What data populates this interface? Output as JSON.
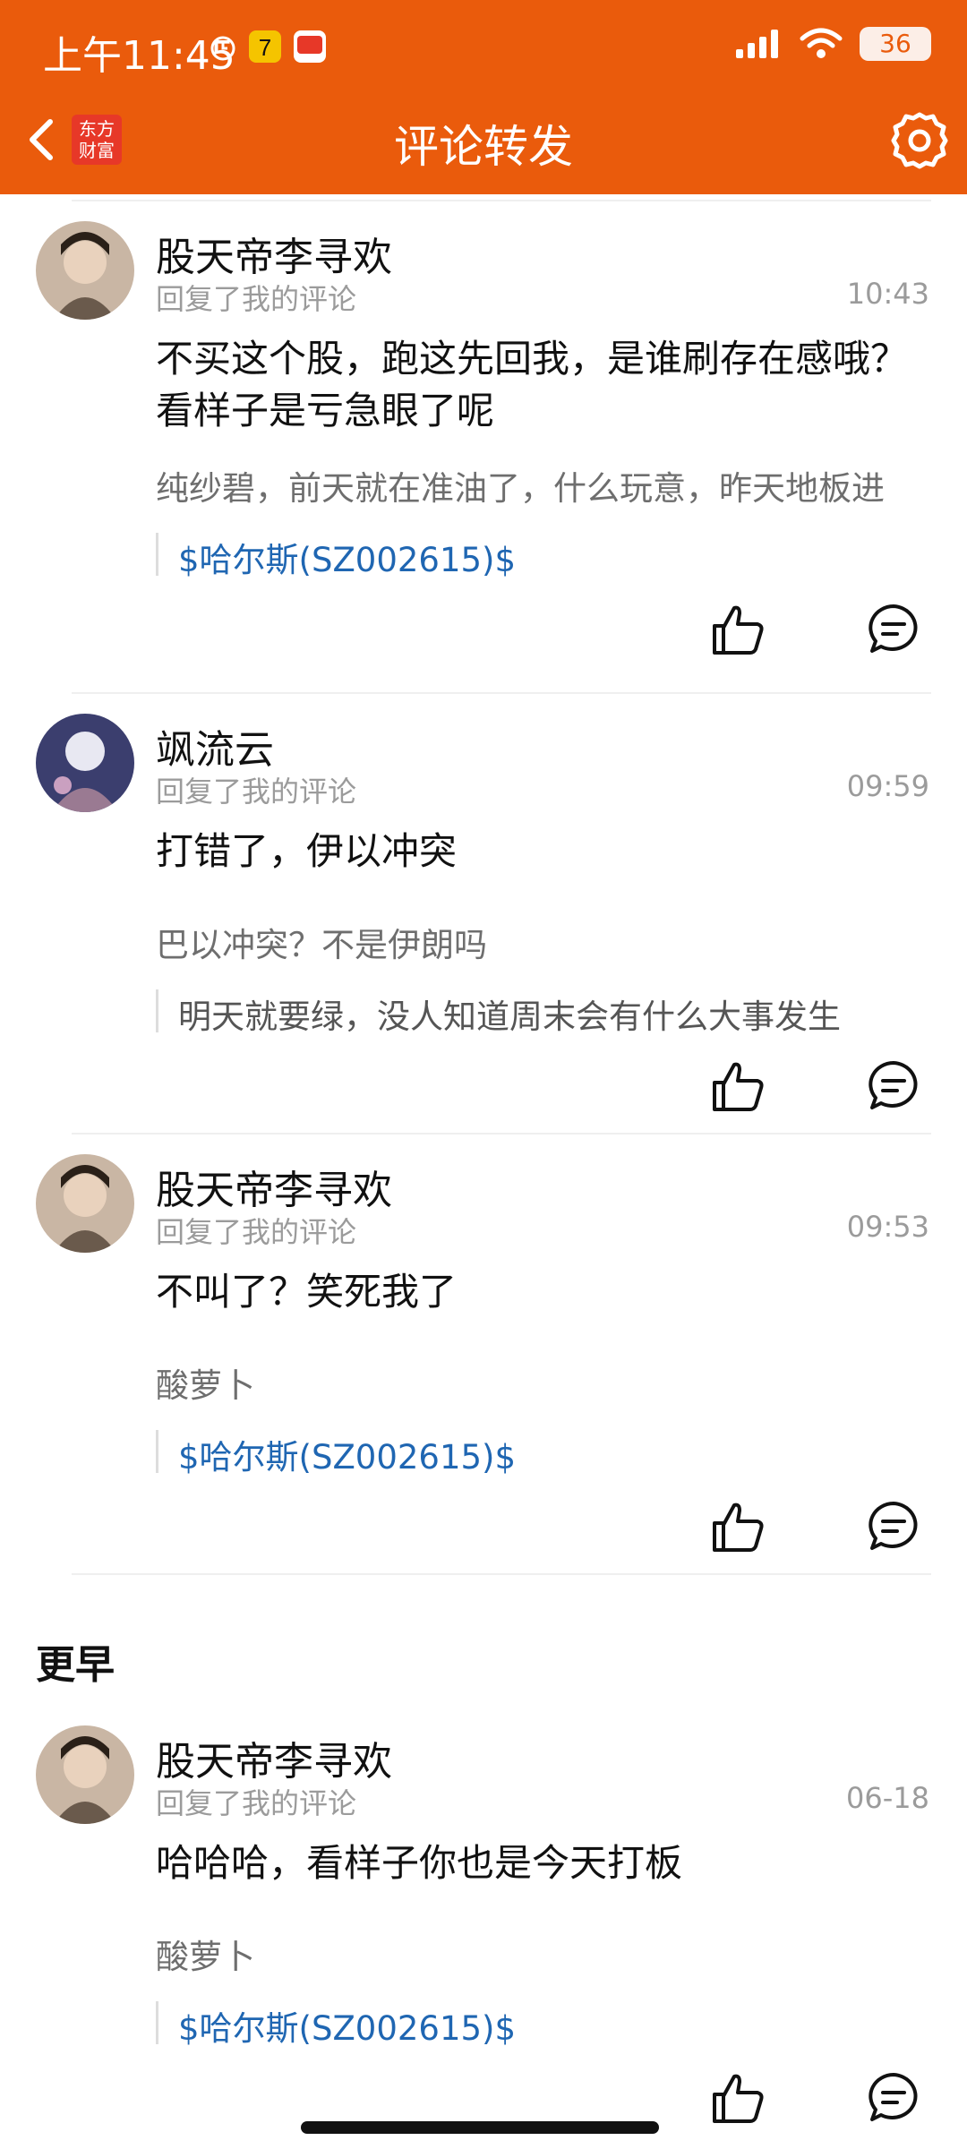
{
  "status_bar": {
    "time": "上午11:45",
    "battery": "36"
  },
  "nav": {
    "title": "评论转发",
    "logo_text": "东方\n财富"
  },
  "items": [
    {
      "user": "股天帝李寻欢",
      "subtitle": "回复了我的评论",
      "time": "10:43",
      "reply": "不买这个股，跑这先回我，是谁刷存在感哦？看样子是亏急眼了呢",
      "original": "纯纱碧，前天就在准油了，什么玩意，昨天地板进",
      "quote": "$哈尔斯(SZ002615)$",
      "quote_is_link": true
    },
    {
      "user": "飒流云",
      "subtitle": "回复了我的评论",
      "time": "09:59",
      "reply": "打错了，伊以冲突",
      "original": "巴以冲突？不是伊朗吗",
      "quote": "明天就要绿，没人知道周末会有什么大事发生",
      "quote_is_link": false
    },
    {
      "user": "股天帝李寻欢",
      "subtitle": "回复了我的评论",
      "time": "09:53",
      "reply": "不叫了？笑死我了",
      "original": "酸萝卜",
      "quote": "$哈尔斯(SZ002615)$",
      "quote_is_link": true
    }
  ],
  "earlier_label": "更早",
  "earlier_items": [
    {
      "user": "股天帝李寻欢",
      "subtitle": "回复了我的评论",
      "time": "06-18",
      "reply": "哈哈哈，看样子你也是今天打板",
      "original": "酸萝卜",
      "quote": "$哈尔斯(SZ002615)$",
      "quote_is_link": true
    }
  ],
  "colors": {
    "brand": "#ea5b0c",
    "link": "#1f66b2"
  }
}
